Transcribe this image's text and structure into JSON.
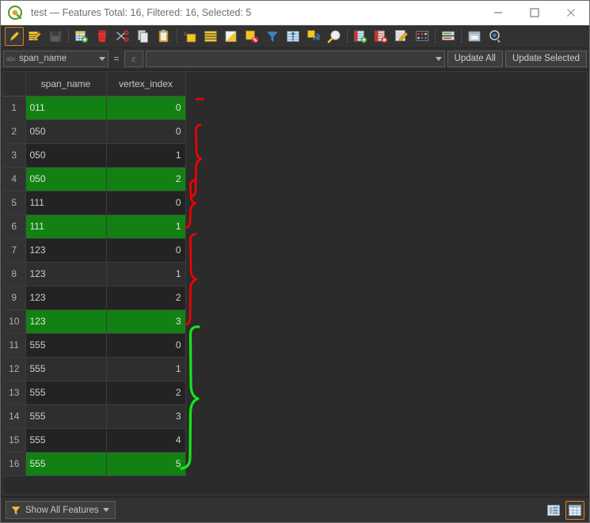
{
  "window": {
    "title": "test — Features Total: 16, Filtered: 16, Selected: 5",
    "app_icon": "qgis-logo-icon",
    "controls": {
      "minimize": "minimize-icon",
      "maximize": "maximize-icon",
      "close": "close-icon"
    }
  },
  "toolbar": {
    "items": [
      {
        "name": "toggle-editing",
        "icon": "pencil-icon",
        "active": true,
        "enabled": true
      },
      {
        "name": "edit-table",
        "icon": "table-pencil-icon",
        "active": false,
        "enabled": true
      },
      {
        "name": "save-edits",
        "icon": "floppy-disk-icon",
        "active": false,
        "enabled": false
      },
      {
        "name": "separator",
        "icon": "separator",
        "active": false,
        "enabled": true
      },
      {
        "name": "add-feature",
        "icon": "table-add-icon",
        "active": false,
        "enabled": true
      },
      {
        "name": "delete-selected-features",
        "icon": "trash-icon",
        "active": false,
        "enabled": true
      },
      {
        "name": "cut-features",
        "icon": "scissors-icon",
        "active": false,
        "enabled": true
      },
      {
        "name": "copy-features",
        "icon": "copy-icon",
        "active": false,
        "enabled": true
      },
      {
        "name": "paste-features",
        "icon": "clipboard-paste-icon",
        "active": false,
        "enabled": true
      },
      {
        "name": "separator",
        "icon": "separator",
        "active": false,
        "enabled": true
      },
      {
        "name": "select-by-expression",
        "icon": "select-expression-icon",
        "active": false,
        "enabled": true
      },
      {
        "name": "select-all",
        "icon": "select-all-icon",
        "active": false,
        "enabled": true
      },
      {
        "name": "invert-selection",
        "icon": "invert-selection-icon",
        "active": false,
        "enabled": true
      },
      {
        "name": "deselect-all",
        "icon": "deselect-all-icon",
        "active": false,
        "enabled": true
      },
      {
        "name": "filter-select",
        "icon": "funnel-icon",
        "active": false,
        "enabled": true
      },
      {
        "name": "move-selection-to-top",
        "icon": "move-top-icon",
        "active": false,
        "enabled": true
      },
      {
        "name": "pan-map-to-feature",
        "icon": "pan-map-icon",
        "active": false,
        "enabled": true
      },
      {
        "name": "zoom-map-to-selection",
        "icon": "zoom-selection-icon",
        "active": false,
        "enabled": true
      },
      {
        "name": "separator",
        "icon": "separator",
        "active": false,
        "enabled": true
      },
      {
        "name": "new-field",
        "icon": "new-field-icon",
        "active": false,
        "enabled": true
      },
      {
        "name": "delete-field",
        "icon": "delete-field-icon",
        "active": false,
        "enabled": true
      },
      {
        "name": "open-field-calculator",
        "icon": "field-calculator-icon",
        "active": false,
        "enabled": true
      },
      {
        "name": "conditional-formatting",
        "icon": "conditional-format-icon",
        "active": false,
        "enabled": true
      },
      {
        "name": "separator",
        "icon": "separator",
        "active": false,
        "enabled": true
      },
      {
        "name": "organize-columns",
        "icon": "organize-columns-icon",
        "active": false,
        "enabled": true
      },
      {
        "name": "separator",
        "icon": "separator",
        "active": false,
        "enabled": true
      },
      {
        "name": "dock-undock",
        "icon": "dock-window-icon",
        "active": false,
        "enabled": true
      },
      {
        "name": "actions",
        "icon": "action-run-icon",
        "active": false,
        "enabled": true
      }
    ]
  },
  "fieldbar": {
    "field_tag": "abc",
    "field_value": "span_name",
    "equals": "=",
    "expression_button_glyph": "ε",
    "expression_value": "",
    "expression_placeholder": "",
    "update_all_label": "Update All",
    "update_selected_label": "Update Selected"
  },
  "table": {
    "columns": [
      "span_name",
      "vertex_index"
    ],
    "rows": [
      {
        "n": "1",
        "span_name": "011",
        "vertex_index": "0",
        "selected": true
      },
      {
        "n": "2",
        "span_name": "050",
        "vertex_index": "0",
        "selected": false
      },
      {
        "n": "3",
        "span_name": "050",
        "vertex_index": "1",
        "selected": false
      },
      {
        "n": "4",
        "span_name": "050",
        "vertex_index": "2",
        "selected": true
      },
      {
        "n": "5",
        "span_name": "111",
        "vertex_index": "0",
        "selected": false
      },
      {
        "n": "6",
        "span_name": "111",
        "vertex_index": "1",
        "selected": true
      },
      {
        "n": "7",
        "span_name": "123",
        "vertex_index": "0",
        "selected": false
      },
      {
        "n": "8",
        "span_name": "123",
        "vertex_index": "1",
        "selected": false
      },
      {
        "n": "9",
        "span_name": "123",
        "vertex_index": "2",
        "selected": false
      },
      {
        "n": "10",
        "span_name": "123",
        "vertex_index": "3",
        "selected": true
      },
      {
        "n": "11",
        "span_name": "555",
        "vertex_index": "0",
        "selected": false
      },
      {
        "n": "12",
        "span_name": "555",
        "vertex_index": "1",
        "selected": false
      },
      {
        "n": "13",
        "span_name": "555",
        "vertex_index": "2",
        "selected": false
      },
      {
        "n": "14",
        "span_name": "555",
        "vertex_index": "3",
        "selected": false
      },
      {
        "n": "15",
        "span_name": "555",
        "vertex_index": "4",
        "selected": false
      },
      {
        "n": "16",
        "span_name": "555",
        "vertex_index": "5",
        "selected": true
      }
    ]
  },
  "annotations": {
    "color_red": "#f50000",
    "color_green": "#16e616",
    "marks": [
      {
        "name": "brace-group-011",
        "color": "#f50000",
        "note": "tick next to row 1"
      },
      {
        "name": "brace-group-050",
        "color": "#f50000",
        "note": "brace spanning rows 2-4"
      },
      {
        "name": "brace-group-111",
        "color": "#f50000",
        "note": "brace spanning rows 5-6"
      },
      {
        "name": "brace-group-123",
        "color": "#f50000",
        "note": "brace spanning rows 7-10"
      },
      {
        "name": "brace-group-555",
        "color": "#16e616",
        "note": "brace spanning rows 11-16"
      }
    ]
  },
  "statusbar": {
    "filter_label": "Show All Features",
    "filter_icon": "funnel-icon",
    "views": [
      {
        "name": "form-view",
        "icon": "form-view-icon",
        "active": false
      },
      {
        "name": "table-view",
        "icon": "table-view-icon",
        "active": true
      }
    ]
  }
}
